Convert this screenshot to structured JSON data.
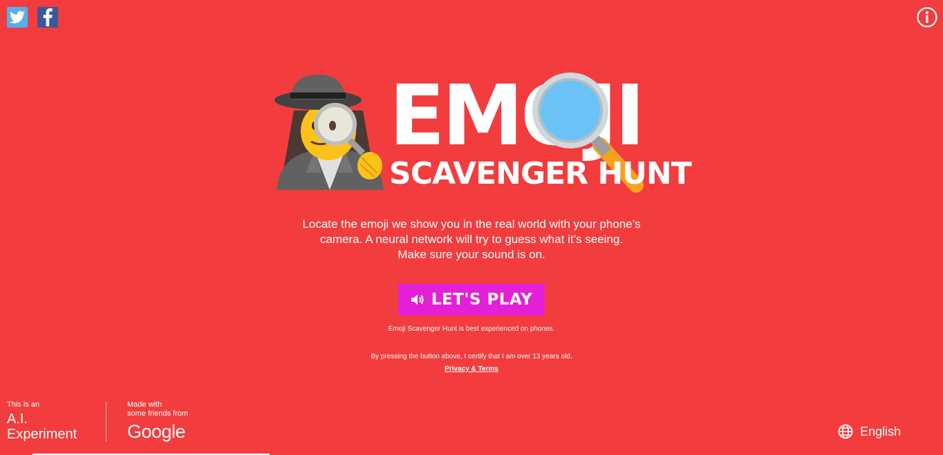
{
  "social": {
    "twitter_icon": "twitter-icon",
    "facebook_icon": "facebook-icon"
  },
  "header": {
    "info_icon": "info-icon"
  },
  "logo": {
    "line1": "EMOJI",
    "line2": "SCAVENGER HUNT",
    "detective_icon": "detective-emoji-icon",
    "magnifier_icon": "magnifying-glass-icon"
  },
  "description": {
    "line1": "Locate the emoji we show you in the real world with your phone’s",
    "line2": "camera. A neural network will try to guess what it’s seeing.",
    "line3": "Make sure your sound is on."
  },
  "play_button": {
    "label": "LET'S PLAY",
    "icon": "speaker-icon",
    "color": "#e320d6"
  },
  "notes": {
    "phones": "Emoji Scavenger Hunt is best experienced on phones.",
    "certify": "By pressing the button above, I certify that I am over 13 years old.",
    "terms_link": "Privacy & Terms"
  },
  "footer": {
    "ai_small": "This is an",
    "ai_line1": "A.I.",
    "ai_line2": "Experiment",
    "made_line1": "Made with",
    "made_line2": "some friends from",
    "google": "Google",
    "language": "English",
    "language_icon": "globe-icon"
  },
  "colors": {
    "background": "#f23c3e",
    "button": "#e320d6",
    "text": "#ffffff"
  }
}
